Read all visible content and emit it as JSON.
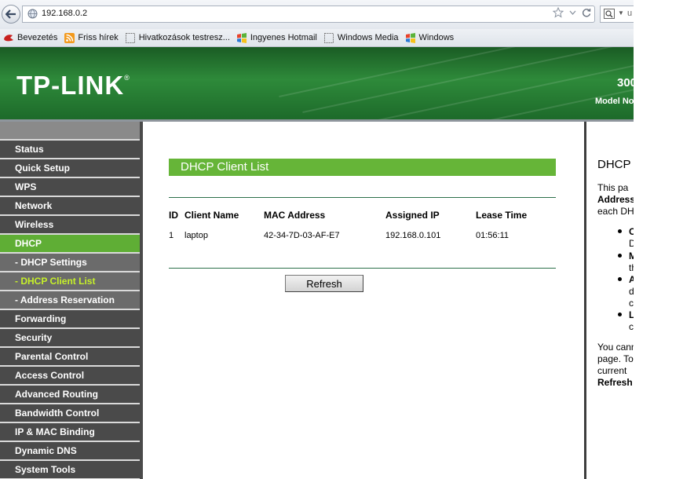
{
  "browser": {
    "url": "192.168.0.2",
    "search_text": "u",
    "bookmarks": [
      "Bevezetés",
      "Friss hírek",
      "Hivatkozások testresz...",
      "Ingyenes Hotmail",
      "Windows Media",
      "Windows"
    ]
  },
  "header": {
    "logo": "TP-LINK",
    "logo_mark": "®",
    "model_number": "300",
    "model_label": "Model No"
  },
  "sidebar": {
    "items": [
      {
        "label": "Status"
      },
      {
        "label": "Quick Setup"
      },
      {
        "label": "WPS"
      },
      {
        "label": "Network"
      },
      {
        "label": "Wireless"
      },
      {
        "label": "DHCP"
      },
      {
        "label": "- DHCP Settings"
      },
      {
        "label": "- DHCP Client List"
      },
      {
        "label": "- Address Reservation"
      },
      {
        "label": "Forwarding"
      },
      {
        "label": "Security"
      },
      {
        "label": "Parental Control"
      },
      {
        "label": "Access Control"
      },
      {
        "label": "Advanced Routing"
      },
      {
        "label": "Bandwidth Control"
      },
      {
        "label": "IP & MAC Binding"
      },
      {
        "label": "Dynamic DNS"
      },
      {
        "label": "System Tools"
      }
    ]
  },
  "main": {
    "title": "DHCP Client List",
    "columns": [
      "ID",
      "Client Name",
      "MAC Address",
      "Assigned IP",
      "Lease Time"
    ],
    "rows": [
      {
        "id": "1",
        "client_name": "laptop",
        "mac": "42-34-7D-03-AF-E7",
        "ip": "192.168.0.101",
        "lease": "01:56:11"
      }
    ],
    "refresh_label": "Refresh"
  },
  "help": {
    "title": "DHCP",
    "lines": [
      "This   pa",
      "Address",
      "each DH"
    ],
    "bullets": [
      {
        "head": "C",
        "rest": "D"
      },
      {
        "head": "M",
        "rest": "th"
      },
      {
        "head": "A",
        "rest": "d",
        "rest2": "c"
      },
      {
        "head": "L",
        "rest": "c"
      }
    ],
    "footer": [
      "You cann",
      "page. To",
      "current",
      "Refresh"
    ]
  },
  "colors": {
    "brand_green": "#2e8a3a",
    "title_green": "#66b538",
    "active_menu": "#5fae35",
    "menu_dark": "#4a4a4a",
    "current_text": "#c6f02a"
  }
}
